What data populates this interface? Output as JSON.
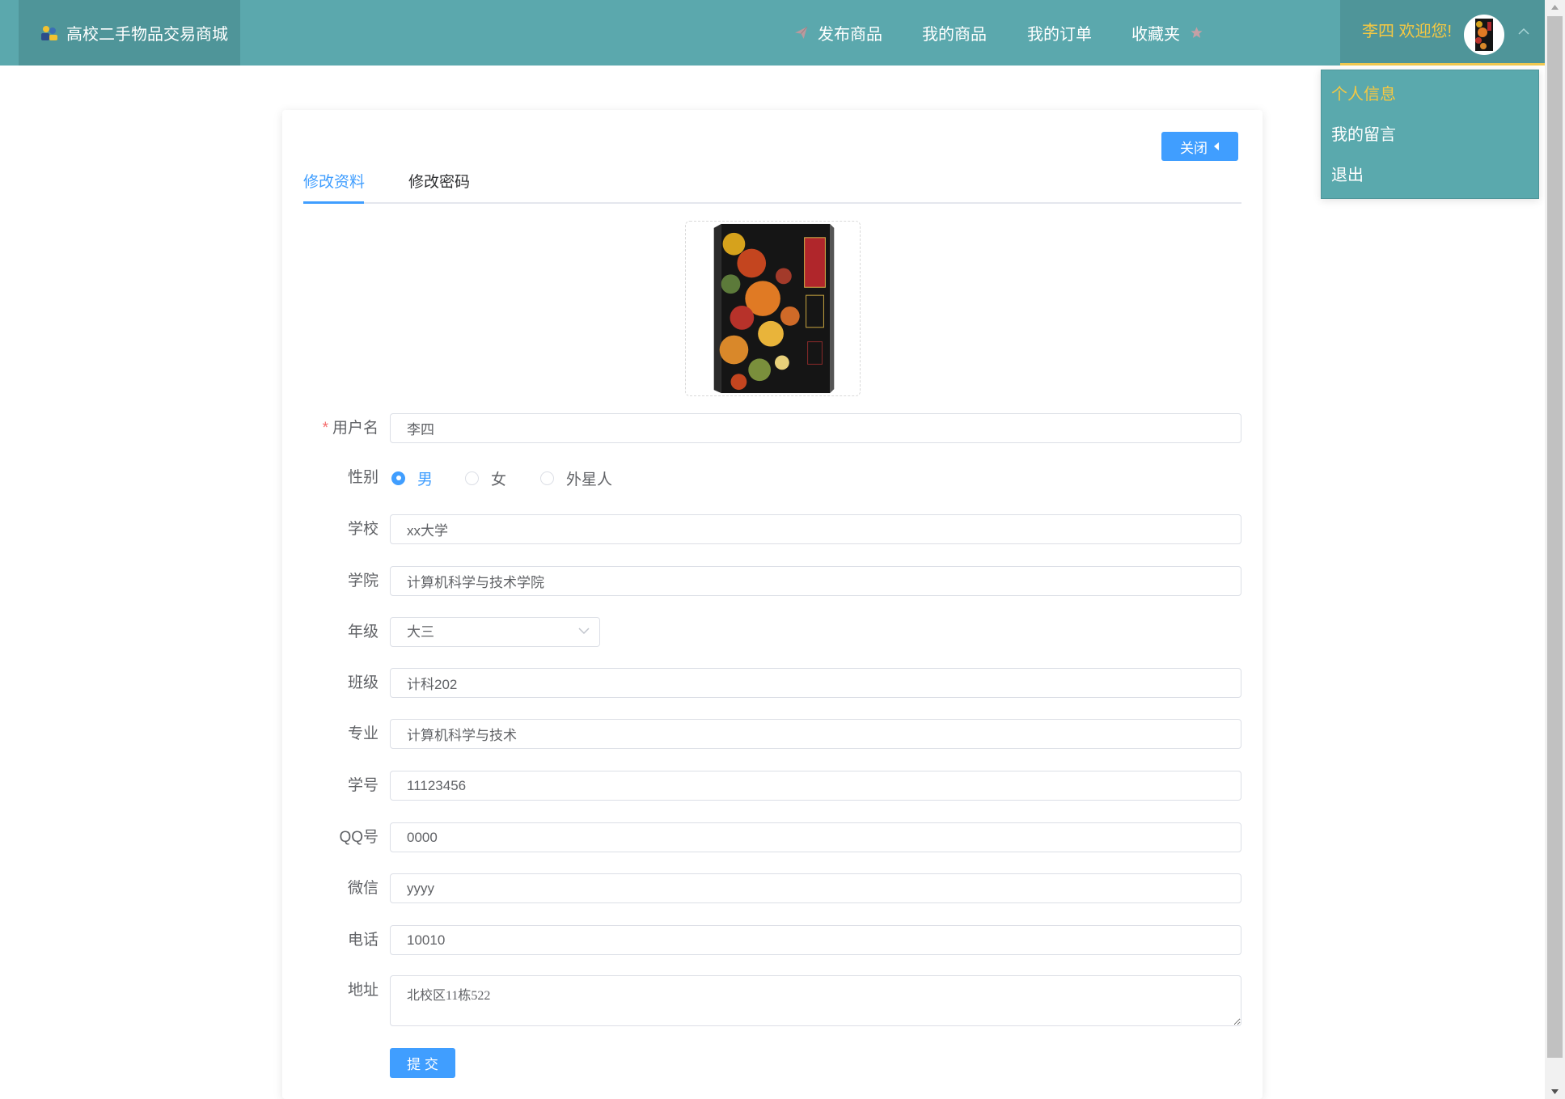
{
  "header": {
    "logo_text": "高校二手物品交易商城",
    "logo_icon": "people-logo-icon",
    "nav": [
      {
        "label": "发布商品",
        "icon": "send-icon"
      },
      {
        "label": "我的商品"
      },
      {
        "label": "我的订单"
      },
      {
        "label": "收藏夹",
        "icon": "star-icon"
      }
    ],
    "user": {
      "welcome": "李四 欢迎您!",
      "avatar": "book-cover-avatar",
      "toggle_icon": "chevron-up-icon"
    }
  },
  "user_menu": {
    "items": [
      "个人信息",
      "我的留言",
      "退出"
    ],
    "active": "个人信息"
  },
  "card": {
    "close_label": "关闭",
    "close_icon": "caret-left-icon",
    "tabs": [
      "修改资料",
      "修改密码"
    ],
    "active_tab": "修改资料",
    "avatar_upload": {
      "image": "book-cover-image"
    },
    "form": {
      "username": {
        "label": "用户名",
        "value": "李四",
        "required_mark": "*"
      },
      "gender": {
        "label": "性别",
        "options": [
          "男",
          "女",
          "外星人"
        ],
        "selected": "男"
      },
      "school": {
        "label": "学校",
        "value": "xx大学"
      },
      "college": {
        "label": "学院",
        "value": "计算机科学与技术学院"
      },
      "grade": {
        "label": "年级",
        "value": "大三"
      },
      "class": {
        "label": "班级",
        "value": "计科202"
      },
      "major": {
        "label": "专业",
        "value": "计算机科学与技术"
      },
      "student_id": {
        "label": "学号",
        "value": "11123456"
      },
      "qq": {
        "label": "QQ号",
        "value": "0000"
      },
      "wechat": {
        "label": "微信",
        "value": "yyyy"
      },
      "phone": {
        "label": "电话",
        "value": "10010"
      },
      "address": {
        "label": "地址",
        "value": "北校区11栋522"
      }
    },
    "submit_label": "提 交"
  },
  "colors": {
    "navbar": "#5ba8ad",
    "navbar_dark": "#4f9599",
    "accent_yellow": "#f5c842",
    "primary": "#409eff",
    "required": "#f56c6c"
  }
}
